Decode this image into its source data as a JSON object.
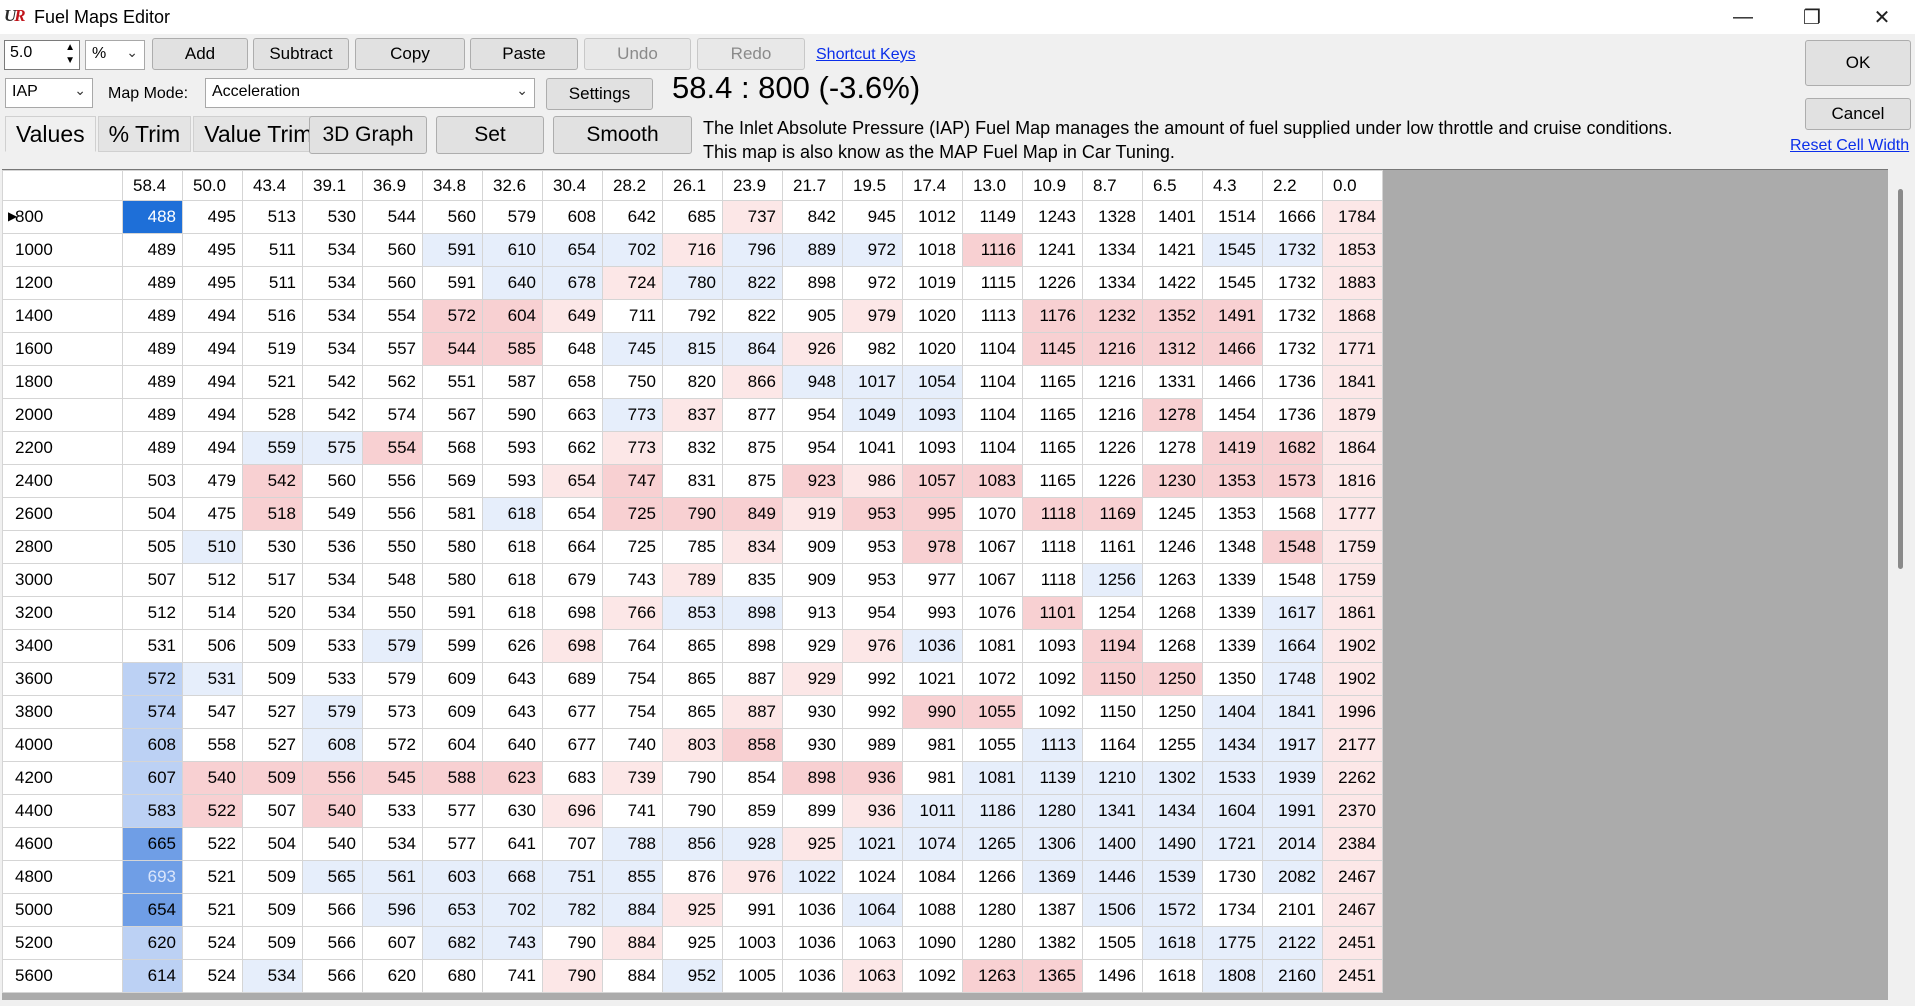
{
  "window": {
    "title": "Fuel Maps Editor",
    "logo": "UR",
    "minimize_icon": "—",
    "maximize_icon": "❐",
    "close_icon": "✕"
  },
  "toolbar": {
    "step_value": "5.0",
    "unit": "%",
    "add": "Add",
    "subtract": "Subtract",
    "copy": "Copy",
    "paste": "Paste",
    "undo": "Undo",
    "redo": "Redo",
    "shortcut_keys": "Shortcut Keys",
    "map_source": "IAP",
    "map_mode_label": "Map Mode:",
    "map_mode": "Acceleration",
    "settings": "Settings",
    "ratio_readout": "58.4 : 800 (-3.6%)",
    "ok": "OK",
    "cancel": "Cancel",
    "reset_cell_width": "Reset Cell Width"
  },
  "tabs": [
    "Values",
    "% Trim",
    "Value Trim"
  ],
  "actions": {
    "graph3d": "3D Graph",
    "set": "Set",
    "smooth": "Smooth"
  },
  "description": {
    "line1": "The Inlet Absolute Pressure (IAP) Fuel Map manages the amount of fuel supplied under low throttle and cruise conditions.",
    "line2": "This map is also know as the MAP Fuel Map in Car Tuning."
  },
  "grid": {
    "columns": [
      "58.4",
      "50.0",
      "43.4",
      "39.1",
      "36.9",
      "34.8",
      "32.6",
      "30.4",
      "28.2",
      "26.1",
      "23.9",
      "21.7",
      "19.5",
      "17.4",
      "13.0",
      "10.9",
      "8.7",
      "6.5",
      "4.3",
      "2.2",
      "0.0"
    ],
    "rows": [
      {
        "rpm": "800",
        "values": [
          488,
          495,
          513,
          530,
          544,
          560,
          579,
          608,
          642,
          685,
          737,
          842,
          945,
          1012,
          1149,
          1243,
          1328,
          1401,
          1514,
          1666,
          1784
        ]
      },
      {
        "rpm": "1000",
        "values": [
          489,
          495,
          511,
          534,
          560,
          591,
          610,
          654,
          702,
          716,
          796,
          889,
          972,
          1018,
          1116,
          1241,
          1334,
          1421,
          1545,
          1732,
          1853
        ]
      },
      {
        "rpm": "1200",
        "values": [
          489,
          495,
          511,
          534,
          560,
          591,
          640,
          678,
          724,
          780,
          822,
          898,
          972,
          1019,
          1115,
          1226,
          1334,
          1422,
          1545,
          1732,
          1883
        ]
      },
      {
        "rpm": "1400",
        "values": [
          489,
          494,
          516,
          534,
          554,
          572,
          604,
          649,
          711,
          792,
          822,
          905,
          979,
          1020,
          1113,
          1176,
          1232,
          1352,
          1491,
          1732,
          1868
        ]
      },
      {
        "rpm": "1600",
        "values": [
          489,
          494,
          519,
          534,
          557,
          544,
          585,
          648,
          745,
          815,
          864,
          926,
          982,
          1020,
          1104,
          1145,
          1216,
          1312,
          1466,
          1732,
          1771
        ]
      },
      {
        "rpm": "1800",
        "values": [
          489,
          494,
          521,
          542,
          562,
          551,
          587,
          658,
          750,
          820,
          866,
          948,
          1017,
          1054,
          1104,
          1165,
          1216,
          1331,
          1466,
          1736,
          1841
        ]
      },
      {
        "rpm": "2000",
        "values": [
          489,
          494,
          528,
          542,
          574,
          567,
          590,
          663,
          773,
          837,
          877,
          954,
          1049,
          1093,
          1104,
          1165,
          1216,
          1278,
          1454,
          1736,
          1879
        ]
      },
      {
        "rpm": "2200",
        "values": [
          489,
          494,
          559,
          575,
          554,
          568,
          593,
          662,
          773,
          832,
          875,
          954,
          1041,
          1093,
          1104,
          1165,
          1226,
          1278,
          1419,
          1682,
          1864
        ]
      },
      {
        "rpm": "2400",
        "values": [
          503,
          479,
          542,
          560,
          556,
          569,
          593,
          654,
          747,
          831,
          875,
          923,
          986,
          1057,
          1083,
          1165,
          1226,
          1230,
          1353,
          1573,
          1816
        ]
      },
      {
        "rpm": "2600",
        "values": [
          504,
          475,
          518,
          549,
          556,
          581,
          618,
          654,
          725,
          790,
          849,
          919,
          953,
          995,
          1070,
          1118,
          1169,
          1245,
          1353,
          1568,
          1777
        ]
      },
      {
        "rpm": "2800",
        "values": [
          505,
          510,
          530,
          536,
          550,
          580,
          618,
          664,
          725,
          785,
          834,
          909,
          953,
          978,
          1067,
          1118,
          1161,
          1246,
          1348,
          1548,
          1759
        ]
      },
      {
        "rpm": "3000",
        "values": [
          507,
          512,
          517,
          534,
          548,
          580,
          618,
          679,
          743,
          789,
          835,
          909,
          953,
          977,
          1067,
          1118,
          1256,
          1263,
          1339,
          1548,
          1759
        ]
      },
      {
        "rpm": "3200",
        "values": [
          512,
          514,
          520,
          534,
          550,
          591,
          618,
          698,
          766,
          853,
          898,
          913,
          954,
          993,
          1076,
          1101,
          1254,
          1268,
          1339,
          1617,
          1861
        ]
      },
      {
        "rpm": "3400",
        "values": [
          531,
          506,
          509,
          533,
          579,
          599,
          626,
          698,
          764,
          865,
          898,
          929,
          976,
          1036,
          1081,
          1093,
          1194,
          1268,
          1339,
          1664,
          1902
        ]
      },
      {
        "rpm": "3600",
        "values": [
          572,
          531,
          509,
          533,
          579,
          609,
          643,
          689,
          754,
          865,
          887,
          929,
          992,
          1021,
          1072,
          1092,
          1150,
          1250,
          1350,
          1748,
          1902
        ]
      },
      {
        "rpm": "3800",
        "values": [
          574,
          547,
          527,
          579,
          573,
          609,
          643,
          677,
          754,
          865,
          887,
          930,
          992,
          990,
          1055,
          1092,
          1150,
          1250,
          1404,
          1841,
          1996
        ]
      },
      {
        "rpm": "4000",
        "values": [
          608,
          558,
          527,
          608,
          572,
          604,
          640,
          677,
          740,
          803,
          858,
          930,
          989,
          981,
          1055,
          1113,
          1164,
          1255,
          1434,
          1917,
          2177
        ]
      },
      {
        "rpm": "4200",
        "values": [
          607,
          540,
          509,
          556,
          545,
          588,
          623,
          683,
          739,
          790,
          854,
          898,
          936,
          981,
          1081,
          1139,
          1210,
          1302,
          1533,
          1939,
          2262
        ]
      },
      {
        "rpm": "4400",
        "values": [
          583,
          522,
          507,
          540,
          533,
          577,
          630,
          696,
          741,
          790,
          859,
          899,
          936,
          1011,
          1186,
          1280,
          1341,
          1434,
          1604,
          1991,
          2370
        ]
      },
      {
        "rpm": "4600",
        "values": [
          665,
          522,
          504,
          540,
          534,
          577,
          641,
          707,
          788,
          856,
          928,
          925,
          1021,
          1074,
          1265,
          1306,
          1400,
          1490,
          1721,
          2014,
          2384
        ]
      },
      {
        "rpm": "4800",
        "values": [
          693,
          521,
          509,
          565,
          561,
          603,
          668,
          751,
          855,
          876,
          976,
          1022,
          1024,
          1084,
          1266,
          1369,
          1446,
          1539,
          1730,
          2082,
          2467
        ]
      },
      {
        "rpm": "5000",
        "values": [
          654,
          521,
          509,
          566,
          596,
          653,
          702,
          782,
          884,
          925,
          991,
          1036,
          1064,
          1088,
          1280,
          1387,
          1506,
          1572,
          1734,
          2101,
          2467
        ]
      },
      {
        "rpm": "5200",
        "values": [
          620,
          524,
          509,
          566,
          607,
          682,
          743,
          790,
          884,
          925,
          1003,
          1036,
          1063,
          1090,
          1280,
          1382,
          1505,
          1618,
          1775,
          2122,
          2451
        ]
      },
      {
        "rpm": "5600",
        "values": [
          614,
          524,
          534,
          566,
          620,
          680,
          741,
          790,
          884,
          952,
          1005,
          1036,
          1063,
          1092,
          1263,
          1365,
          1496,
          1618,
          1808,
          2160,
          2451
        ]
      }
    ],
    "colors": {
      "selected": "#1e6fd8",
      "blue_strong": "#6f9ee6",
      "blue_mid": "#bcd1f4",
      "blue_light": "#e6eefb",
      "red_light": "#fce7e7",
      "red_mid": "#f8d0d2"
    }
  }
}
